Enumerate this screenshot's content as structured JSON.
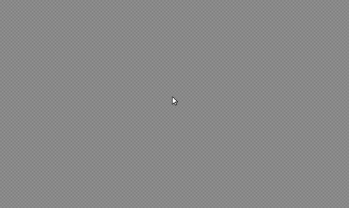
{
  "desktop": {
    "background": "stippled-gray",
    "background_color": "#8e8e8e"
  },
  "cursor": {
    "icon": "arrow-pointer-icon",
    "color": "#ffffff"
  }
}
